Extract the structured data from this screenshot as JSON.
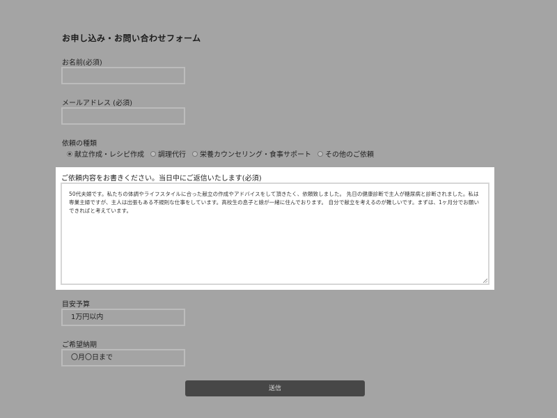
{
  "form": {
    "title": "お申し込み・お問い合わせフォーム",
    "name_label": "お名前(必須)",
    "name_value": "",
    "email_label": "メールアドレス (必須)",
    "email_value": "",
    "type_label": "依頼の種類",
    "type_options": [
      {
        "label": "献立作成・レシピ作成",
        "checked": true
      },
      {
        "label": "調理代行",
        "checked": false
      },
      {
        "label": "栄養カウンセリング・食事サポート",
        "checked": false
      },
      {
        "label": "その他のご依頼",
        "checked": false
      }
    ],
    "content_label": "ご依頼内容をお書きください。当日中にご返信いたします(必須)",
    "content_value": "50代夫婦です。私たちの体調やライフスタイルに合った献立の作成やアドバイスをして頂きたく、依頼致しました。 先日の健康診断で主人が糖尿病と診断されました。私は専業主婦ですが、主人は出張もある不規則な仕事をしています。高校生の息子と娘が一緒に住んでおります。 自分で献立を考えるのが難しいです。まずは、1ヶ月分でお願いできればと考えています。",
    "budget_label": "目安予算",
    "budget_value": "1万円以内",
    "deadline_label": "ご希望納期",
    "deadline_value": "〇月〇日まで",
    "submit_label": "送信"
  },
  "colors": {
    "overlay_background": "#a4a4a4",
    "highlight_background": "#ffffff",
    "submit_background": "#474747"
  }
}
